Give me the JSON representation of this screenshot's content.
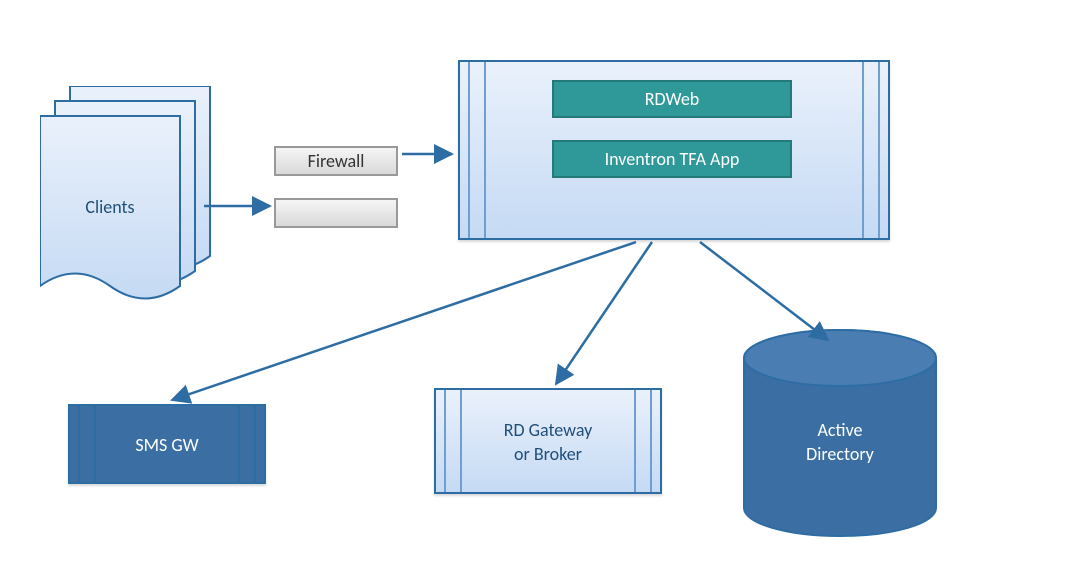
{
  "nodes": {
    "clients": {
      "label": "Clients"
    },
    "firewall": {
      "label": "Firewall"
    },
    "firewall2": {
      "label": ""
    },
    "rdweb": {
      "label": "RDWeb"
    },
    "tfa": {
      "label": "Inventron TFA App"
    },
    "smsgw": {
      "label": "SMS GW"
    },
    "rdgw": {
      "label": "RD Gateway or Broker"
    },
    "ad": {
      "label": "Active Directory"
    }
  },
  "edges": [
    {
      "from": "clients",
      "to": "firewall"
    },
    {
      "from": "firewall",
      "to": "server"
    },
    {
      "from": "server",
      "to": "smsgw"
    },
    {
      "from": "server",
      "to": "rdgw"
    },
    {
      "from": "server",
      "to": "ad"
    }
  ]
}
